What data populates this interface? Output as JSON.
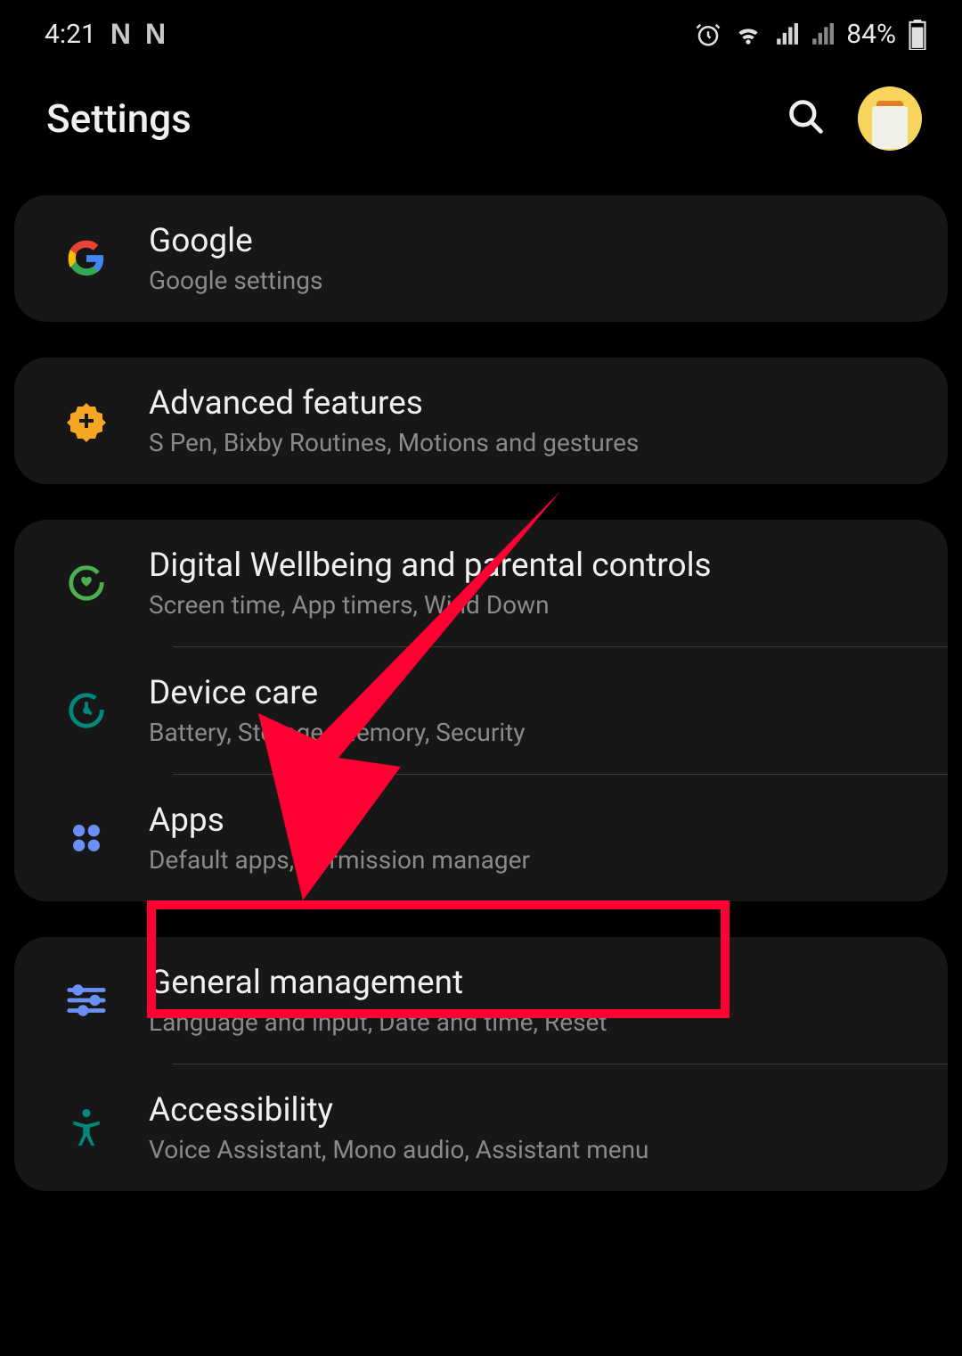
{
  "status_bar": {
    "time": "4:21",
    "battery_percent": "84%",
    "n_icons": [
      "N",
      "N"
    ]
  },
  "header": {
    "title": "Settings"
  },
  "groups": [
    {
      "items": [
        {
          "id": "google",
          "title": "Google",
          "subtitle": "Google settings"
        }
      ]
    },
    {
      "items": [
        {
          "id": "advanced-features",
          "title": "Advanced features",
          "subtitle": "S Pen, Bixby Routines, Motions and gestures"
        }
      ]
    },
    {
      "items": [
        {
          "id": "digital-wellbeing",
          "title": "Digital Wellbeing and parental controls",
          "subtitle": "Screen time, App timers, Wind Down"
        },
        {
          "id": "device-care",
          "title": "Device care",
          "subtitle": "Battery, Storage, Memory, Security"
        },
        {
          "id": "apps",
          "title": "Apps",
          "subtitle": "Default apps, Permission manager"
        }
      ]
    },
    {
      "items": [
        {
          "id": "general-management",
          "title": "General management",
          "subtitle": "Language and input, Date and time, Reset"
        },
        {
          "id": "accessibility",
          "title": "Accessibility",
          "subtitle": "Voice Assistant, Mono audio, Assistant menu"
        }
      ]
    }
  ],
  "annotation": {
    "highlighted_item": "general-management",
    "arrow_color": "#ff0033"
  }
}
